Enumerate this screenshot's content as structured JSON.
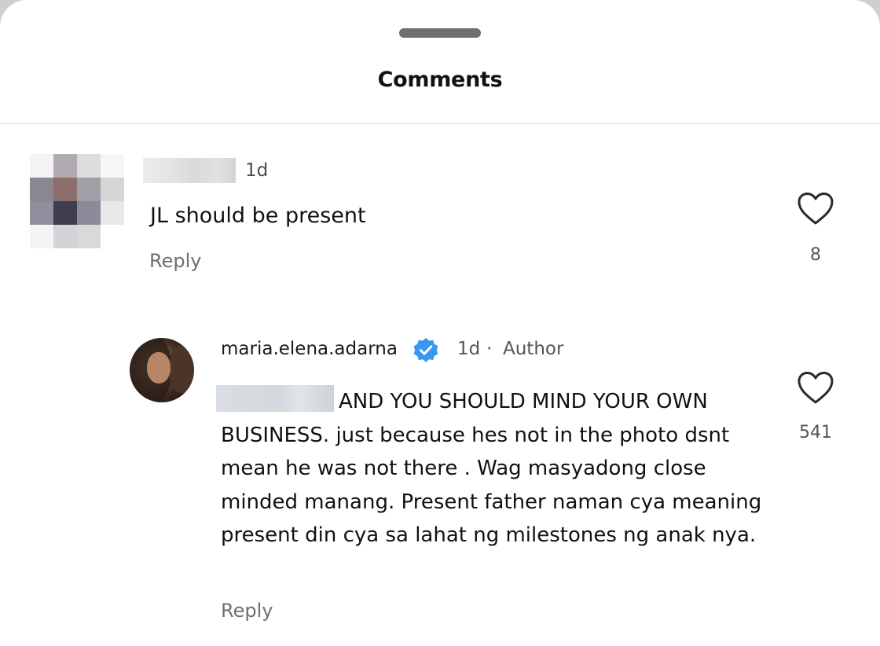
{
  "sheet": {
    "title": "Comments"
  },
  "comments": [
    {
      "time": "1d",
      "text": "JL should be present",
      "reply_label": "Reply",
      "likes": "8",
      "avatar_icon": "pixelated-avatar"
    },
    {
      "username": "maria.elena.adarna",
      "time": "1d",
      "separator": "·",
      "badge": "Author",
      "text": "AND YOU SHOULD MIND YOUR OWN BUSINESS. just because hes not in the photo dsnt mean he was not  there . Wag masyadong close minded manang. Present father naman cya meaning present din cya sa lahat ng milestones ng anak nya.",
      "reply_label": "Reply",
      "likes": "541",
      "verified_icon": "verified-badge-icon",
      "accent_color": "#3897f0"
    }
  ]
}
